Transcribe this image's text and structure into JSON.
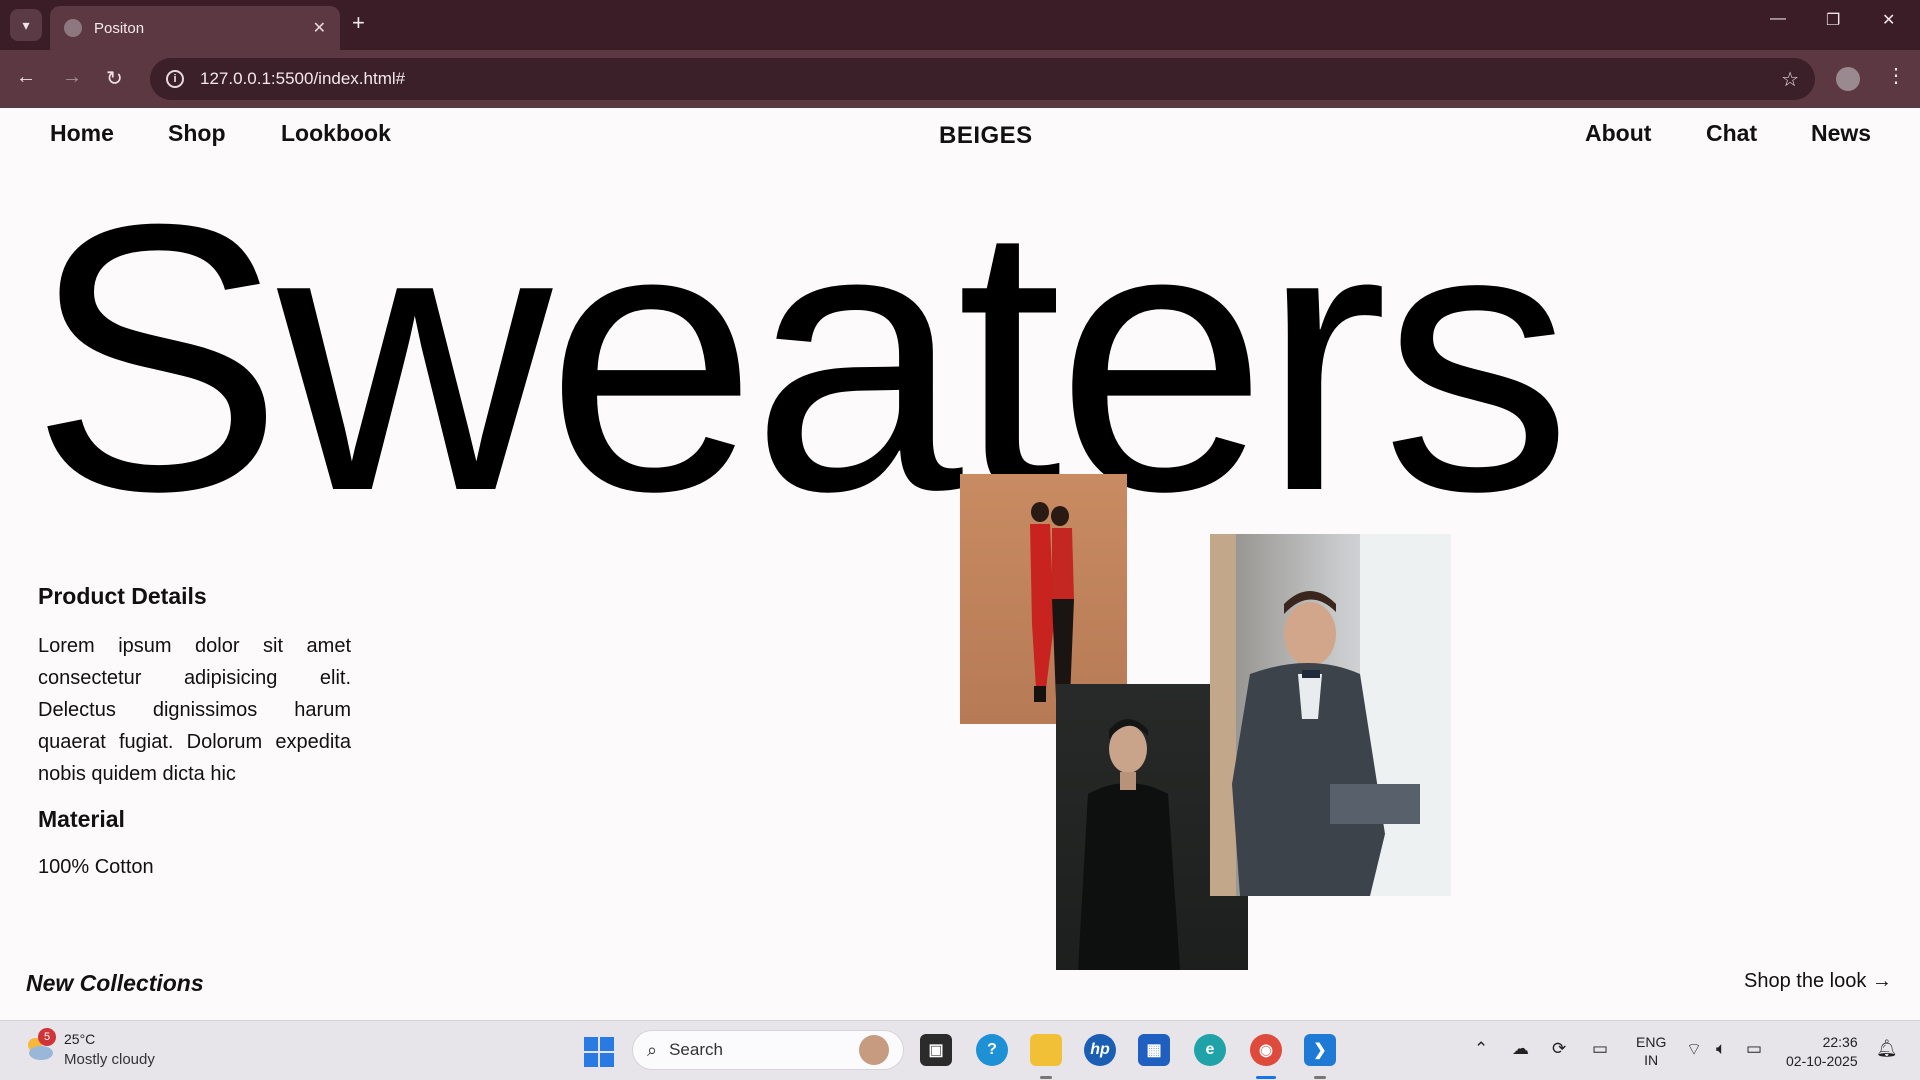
{
  "browser": {
    "tab_title": "Positon",
    "url": "127.0.0.1:5500/index.html#"
  },
  "nav": {
    "left": [
      "Home",
      "Shop",
      "Lookbook"
    ],
    "brand": "BEIGES",
    "right": [
      "About",
      "Chat",
      "News"
    ]
  },
  "hero": {
    "title": "Sweaters"
  },
  "product": {
    "details_heading": "Product Details",
    "details_text": "Lorem ipsum dolor sit amet consectetur adipisicing elit. Delectus dignissimos harum quaerat fugiat. Dolorum expedita nobis quidem dicta hic",
    "material_heading": "Material",
    "material_value": "100% Cotton"
  },
  "footer": {
    "collections": "New Collections",
    "shop_look": "Shop the look →"
  },
  "taskbar": {
    "weather_badge": "5",
    "weather_temp": "25°C",
    "weather_desc": "Mostly cloudy",
    "search_placeholder": "Search",
    "lang_line1": "ENG",
    "lang_line2": "IN",
    "time": "22:36",
    "date": "02-10-2025"
  },
  "colors": {
    "tab_bar": "#3a1d26",
    "toolbar": "#5c3843",
    "page_bg": "#fdfafb"
  }
}
